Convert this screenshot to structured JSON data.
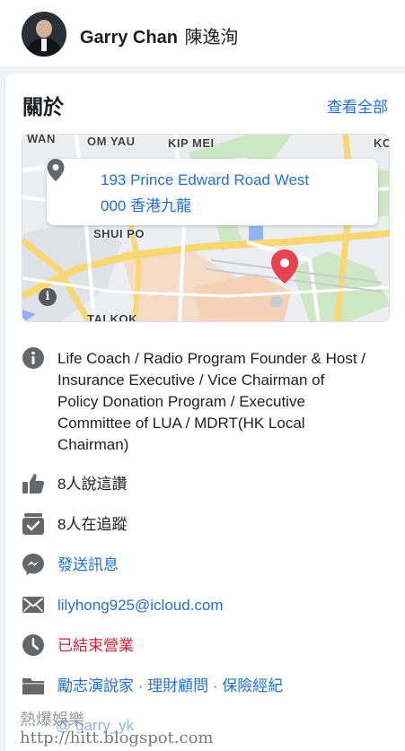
{
  "profile": {
    "name": "Garry Chan",
    "name_cn": "陳逸洵"
  },
  "about": {
    "title": "關於",
    "see_all": "查看全部"
  },
  "map": {
    "labels": [
      "WAN",
      "OM YAU",
      "KIP MEI",
      "KO",
      "SHUI PO",
      "TAI KOK"
    ],
    "address_line1": "193 Prince Edward Road West",
    "address_line2": "000 香港九龍",
    "info_glyph": "i"
  },
  "details": {
    "bio": "Life Coach / Radio Program Founder & Host / Insurance Executive / Vice Chairman of Policy Donation Program / Executive Committee of LUA / MDRT(HK Local Chairman)",
    "likes": "8人說這讚",
    "followers": "8人在追蹤",
    "message": "發送訊息",
    "email": "lilyhong925@icloud.com",
    "hours_status": "已結束營業",
    "categories": [
      "勵志演說家",
      "理財顧問",
      "保險經紀"
    ],
    "category_separator": "·",
    "handle": "garry_yk",
    "handle_prefix": "@"
  },
  "watermark": {
    "line1": "熱爆娛樂",
    "line2": "http://hitt.blogspot.com"
  },
  "colors": {
    "link": "#216fdb",
    "closed": "#d61f33",
    "icon": "#65676b",
    "pin": "#e8414f"
  },
  "icons": {
    "bio": "info-circle-icon",
    "likes": "thumbs-up-icon",
    "followers": "follow-check-icon",
    "message": "messenger-icon",
    "email": "envelope-icon",
    "hours": "clock-icon",
    "categories": "folder-icon",
    "address": "location-pin-icon",
    "map_marker": "map-marker-icon"
  }
}
